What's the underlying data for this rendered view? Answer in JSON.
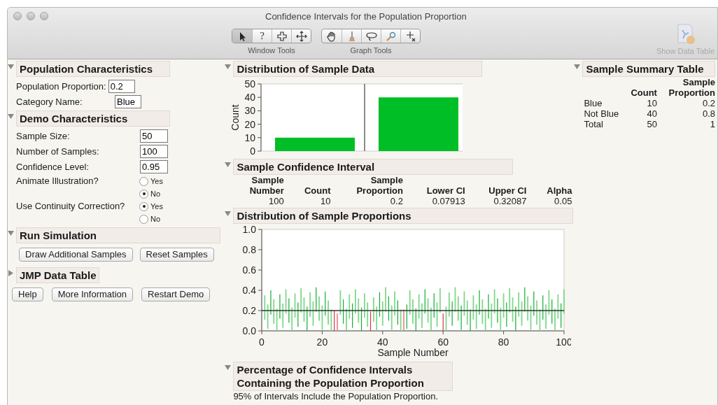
{
  "window": {
    "title": "Confidence Intervals for the Population Proportion"
  },
  "toolbar": {
    "groups": [
      {
        "label": "Window Tools",
        "tools": [
          {
            "kind": "arrow",
            "selected": true
          },
          {
            "kind": "help",
            "glyph": "?",
            "selected": false
          },
          {
            "kind": "crosshair",
            "selected": false
          },
          {
            "kind": "move",
            "selected": false
          }
        ]
      },
      {
        "label": "Graph Tools",
        "tools": [
          {
            "kind": "hand",
            "selected": false
          },
          {
            "kind": "brush",
            "selected": false
          },
          {
            "kind": "lasso",
            "selected": false
          },
          {
            "kind": "magnifier",
            "selected": false
          },
          {
            "kind": "crosshair-small",
            "selected": false
          }
        ]
      }
    ],
    "show_data_table": {
      "label": "Show Data Table",
      "disabled": true
    }
  },
  "population_characteristics": {
    "title": "Population Characteristics",
    "expanded": true,
    "fields": [
      {
        "label": "Population Proportion:",
        "value": "0.2"
      },
      {
        "label": "Category Name:",
        "value": "Blue"
      }
    ]
  },
  "demo_characteristics": {
    "title": "Demo Characteristics",
    "expanded": true,
    "fields": [
      {
        "label": "Sample Size:",
        "value": "50"
      },
      {
        "label": "Number of Samples:",
        "value": "100"
      },
      {
        "label": "Confidence Level:",
        "value": "0.95"
      }
    ],
    "radios": [
      {
        "label": "Animate Illustration?",
        "options": [
          {
            "label": "Yes",
            "selected": false
          },
          {
            "label": "No",
            "selected": true
          }
        ]
      },
      {
        "label": "Use Continuity Correction?",
        "options": [
          {
            "label": "Yes",
            "selected": true
          },
          {
            "label": "No",
            "selected": false
          }
        ]
      }
    ]
  },
  "run_simulation": {
    "title": "Run Simulation",
    "expanded": true,
    "buttons": [
      "Draw Additional Samples",
      "Reset Samples"
    ]
  },
  "jmp_data_table": {
    "title": "JMP Data Table",
    "expanded": false
  },
  "footer_buttons": [
    "Help",
    "More Information",
    "Restart Demo"
  ],
  "distribution_of_sample_data": {
    "title": "Distribution of Sample Data",
    "expanded": true,
    "chart_data": {
      "type": "bar",
      "ylabel": "Count",
      "categories": [
        null,
        null
      ],
      "series": [
        {
          "color": "#00bf26",
          "values": [
            10,
            40
          ]
        }
      ],
      "ylim": [
        0,
        50
      ],
      "yticks": [
        0,
        10,
        20,
        30,
        40,
        50
      ]
    }
  },
  "sample_confidence_interval": {
    "title": "Sample Confidence Interval",
    "expanded": true,
    "columns": [
      {
        "top": "Sample",
        "bottom": "Number"
      },
      {
        "bottom": "Count"
      },
      {
        "top": "Sample",
        "bottom": "Proportion"
      },
      {
        "bottom": "Lower CI"
      },
      {
        "bottom": "Upper CI"
      },
      {
        "bottom": "Alpha"
      }
    ],
    "row": [
      "100",
      "10",
      "0.2",
      "0.07913",
      "0.32087",
      "0.05"
    ]
  },
  "distribution_of_sample_proportions": {
    "title": "Distribution of Sample Proportions",
    "expanded": true,
    "chart_data": {
      "type": "line",
      "xlabel": "Sample Number",
      "xlim": [
        0,
        100
      ],
      "ylim": [
        0,
        1
      ],
      "xticks": [
        0,
        20,
        40,
        60,
        80,
        100
      ],
      "yticks": [
        {
          "value": 0,
          "label": "0.0"
        },
        {
          "value": 0.2,
          "label": "0.2"
        },
        {
          "value": 0.4,
          "label": "0.4"
        },
        {
          "value": 0.6,
          "label": "0.6"
        },
        {
          "value": 0.8,
          "label": "0.8"
        },
        {
          "value": 1,
          "label": "1.0"
        }
      ]
    }
  },
  "percentage_section": {
    "title_lines": [
      "Percentage of Confidence Intervals",
      "Containing the Population Proportion"
    ],
    "expanded": true,
    "text": "95% of Intervals Include the Population Proportion."
  },
  "sample_summary_table": {
    "title": "Sample Summary Table",
    "expanded": true,
    "columns": [
      null,
      {
        "bottom": "Count"
      },
      {
        "top": "Sample",
        "bottom": "Proportion"
      }
    ],
    "rows": [
      [
        "Blue",
        "10",
        "0.2"
      ],
      [
        "Not Blue",
        "40",
        "0.8"
      ],
      [
        "Total",
        "50",
        "1"
      ]
    ]
  }
}
